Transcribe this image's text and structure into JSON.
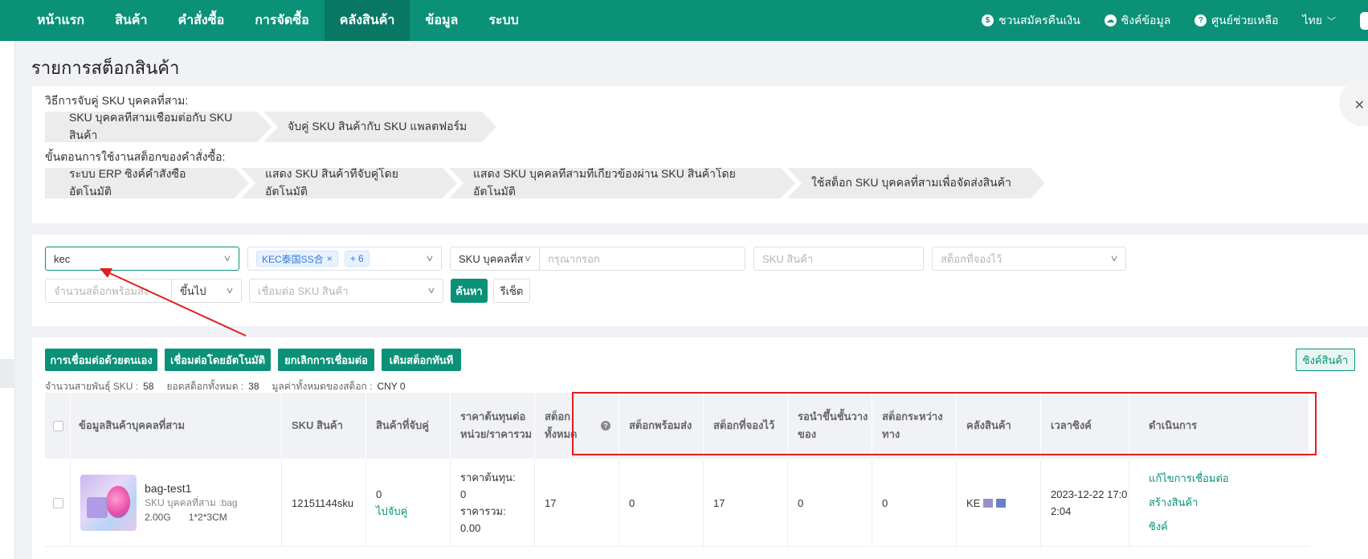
{
  "nav": {
    "items": [
      "หน้าแรก",
      "สินค้า",
      "คำสั่งซื้อ",
      "การจัดซื้อ",
      "คลังสินค้า",
      "ข้อมูล",
      "ระบบ"
    ],
    "active_index": 4,
    "refund": "ชวนสมัครคืนเงิน",
    "sync": "ซิงค์ข้อมูล",
    "help": "ศูนย์ช่วยเหลือ",
    "lang": "ไทย"
  },
  "page_title": "รายการสต็อกสินค้า",
  "guide": {
    "pair_label": "วิธีการจับคู่ SKU บุคคลที่สาม:",
    "pair_steps": [
      "SKU บุคคลที่สามเชื่อมต่อกับ SKU สินค้า",
      "จับคู่ SKU สินค้ากับ SKU แพลตฟอร์ม"
    ],
    "flow_label": "ขั้นตอนการใช้งานสต็อกของคำสั่งซื้อ:",
    "flow_steps": [
      "ระบบ ERP ซิงค์คำสั่งซื้ออัตโนมัติ",
      "แสดง SKU สินค้าที่จับคู่โดยอัตโนมัติ",
      "แสดง SKU บุคคลที่สามที่เกี่ยวข้องผ่าน SKU สินค้าโดยอัตโนมัติ",
      "ใช้สต็อก SKU บุคคลที่สามเพื่อจัดส่งสินค้า"
    ]
  },
  "filters": {
    "search_value": "kec",
    "warehouse_tag": "KEC泰国SS合",
    "warehouse_more": "+ 6",
    "sku_type": "SKU บุคคลที่ส",
    "sku_input_ph": "กรุณากรอก",
    "product_sku_ph": "SKU สินค้า",
    "reserved_ph": "สต็อกที่จองไว้",
    "qty_ph": "จำนวนสต็อกพร้อมส่ง",
    "qty_op": "ขึ้นไป",
    "link_ph": "เชื่อมต่อ SKU สินค้า",
    "search_btn": "ค้นหา",
    "reset_btn": "รีเซ็ต"
  },
  "actions": {
    "manual": "การเชื่อมต่อด้วยตนเอง",
    "auto": "เชื่อมต่อโดยอัตโนมัติ",
    "cancel": "ยกเลิกการเชื่อมต่อ",
    "add_stock": "เติมสต็อกทันที",
    "sync_product": "ซิงค์สินค้า"
  },
  "summary": {
    "sku_label": "จำนวนสายพันธุ์ SKU :",
    "sku_value": "58",
    "total_label": "ยอดสต็อกทั้งหมด :",
    "total_value": "38",
    "value_label": "มูลค่าทั้งหมดของสต็อก :",
    "value_value": "CNY 0"
  },
  "table": {
    "headers": [
      "ข้อมูลสินค้าบุคคลที่สาม",
      "SKU สินค้า",
      "สินค้าที่จับคู่",
      "ราคาต้นทุนต่อหน่วย/ราคารวม",
      "สต็อกทั้งหมด",
      "สต็อกพร้อมส่ง",
      "สต็อกที่จองไว้",
      "รอนำขึ้นชั้นวางของ",
      "สต็อกระหว่างทาง",
      "คลังสินค้า",
      "เวลาซิงค์",
      "ดำเนินการ"
    ],
    "row": {
      "name": "bag-test1",
      "third_sku": "SKU บุคคลที่สาม :bag",
      "weight": "2.00G",
      "size": "1*2*3CM",
      "product_sku": "12151144sku",
      "matched_count": "0",
      "matched_link": "ไปจับคู่",
      "unit_cost_label": "ราคาต้นทุน:",
      "unit_cost": "0",
      "total_label": "ราคารวม:",
      "total": "0.00",
      "stock_total": "17",
      "stock_ready": "0",
      "stock_reserved": "17",
      "pending_shelf": "0",
      "in_transit": "0",
      "warehouse": "KE",
      "sync_time": "2023-12-22 17:02:04",
      "op_edit": "แก้ไขการเชื่อมต่อ",
      "op_create": "สร้างสินค้า",
      "op_sync": "ซิงค์"
    }
  },
  "colors": {
    "brand": "#0a9178",
    "annotation": "#e02020"
  }
}
